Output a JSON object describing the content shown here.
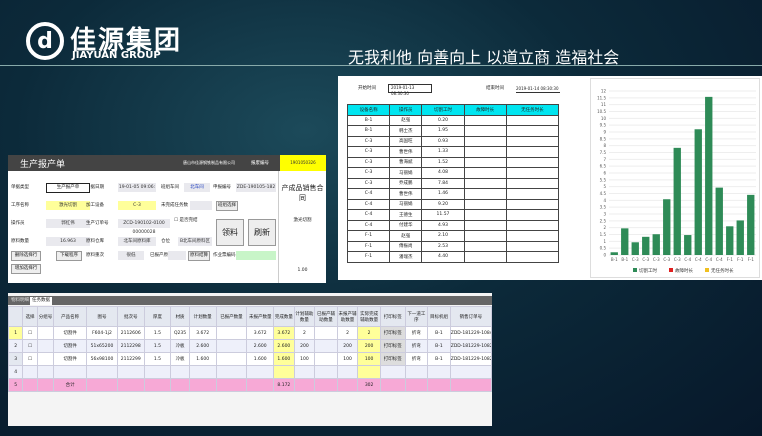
{
  "header": {
    "logo_mark": "d",
    "logo_cn": "佳源集团",
    "logo_en": "JIAYUAN GROUP",
    "slogan": "无我利他  向善向上  以道立商  造福社会"
  },
  "form": {
    "title": "生产报产单",
    "company": "唐山市佳源钢铁制品有限公司",
    "report_no_label": "报废编号",
    "report_no": "1901050326",
    "fields": [
      {
        "label": "单据类型",
        "value": "生产报产单"
      },
      {
        "label": "单据日期",
        "value": "19-01-05 09:06:"
      },
      {
        "label": "班组车间",
        "value": "北车间"
      },
      {
        "label": "申报编号",
        "value": "ZDE-190105-182"
      },
      {
        "label": "工序名称",
        "value": "激光切割"
      },
      {
        "label": "加工设备",
        "value": "C-3"
      },
      {
        "label": "未完成任务数",
        "value": ""
      },
      {
        "label": "操作员",
        "value": "郭红伟"
      },
      {
        "label": "生产订单号",
        "value": "ZCD-190102-0100  00000028"
      },
      {
        "label": "原料数量",
        "value": "16.963"
      },
      {
        "label": "原料仓库",
        "value": "北车间原料库"
      },
      {
        "label": "仓位",
        "value": "B北车间原料区"
      },
      {
        "label": "原料重次",
        "value": "很低"
      },
      {
        "label": "已报产原料",
        "value": ""
      },
      {
        "label": "作业票编码",
        "value": ""
      }
    ],
    "complete_label": "是否完结",
    "buttons": {
      "team": "班组选择",
      "pick": "领料",
      "refresh": "刷新",
      "delete_row": "删除选择行",
      "download": "下载程序",
      "settle": "原料结算",
      "add_row": "增加选择行"
    },
    "side": {
      "title": "产成品销售合同",
      "process": "激光切割",
      "value": "1.00"
    }
  },
  "report": {
    "start_label": "开始时间",
    "start": "2019-01-13 08:30:30",
    "end_label": "结束时间",
    "end": "2019-01-14 08:30:30",
    "columns": [
      "设备名称",
      "操作员",
      "切割工时",
      "故障时长",
      "无任务时长"
    ],
    "rows": [
      [
        "B-1",
        "赵强",
        "0.20"
      ],
      [
        "B-1",
        "韩士杰",
        "1.95"
      ],
      [
        "C-3",
        "高国旺",
        "0.93"
      ],
      [
        "C-3",
        "曹世伟",
        "1.33"
      ],
      [
        "C-3",
        "曹海斌",
        "1.52"
      ],
      [
        "C-3",
        "马丽娟",
        "4.08"
      ],
      [
        "C-3",
        "乔成鹏",
        "7.84"
      ],
      [
        "C-4",
        "曹世伟",
        "1.46"
      ],
      [
        "C-4",
        "马丽娟",
        "9.20"
      ],
      [
        "C-4",
        "王德生",
        "11.57"
      ],
      [
        "C-4",
        "付建华",
        "4.93"
      ],
      [
        "F-1",
        "赵强",
        "2.10"
      ],
      [
        "F-1",
        "傅振尚",
        "2.53"
      ],
      [
        "F-1",
        "潘瑞杰",
        "4.40"
      ]
    ]
  },
  "chart_data": {
    "type": "bar",
    "categories": [
      "B-1",
      "B-1",
      "C-3",
      "C-3",
      "C-3",
      "C-3",
      "C-3",
      "C-4",
      "C-4",
      "C-4",
      "C-4",
      "F-1",
      "F-1",
      "F-1"
    ],
    "series": [
      {
        "name": "切割工时",
        "color": "#2e8b57",
        "values": [
          0.2,
          1.95,
          0.93,
          1.33,
          1.52,
          4.08,
          7.84,
          1.46,
          9.2,
          11.57,
          4.93,
          2.1,
          2.53,
          4.4
        ]
      },
      {
        "name": "故障时长",
        "color": "#e02020",
        "values": []
      },
      {
        "name": "无任务时长",
        "color": "#f0c020",
        "values": []
      }
    ],
    "ylim": [
      0,
      12
    ],
    "ytick_step": 0.5,
    "grid": true,
    "legend": "bottom"
  },
  "grid": {
    "tabs": [
      "物料明细",
      "任务数据"
    ],
    "columns": [
      "选择",
      "分组号",
      "产品名称",
      "图号",
      "批次号",
      "厚度",
      "材质",
      "计划数量",
      "已报产数量",
      "未报产数量",
      "完成数量",
      "计划辅助数量",
      "已报产辅助数量",
      "未报产辅助数量",
      "实际完成辅助数量",
      "打印标签",
      "下一道工序",
      "目标机组",
      "销售订单号"
    ],
    "rows": [
      [
        "1",
        "",
        "",
        "切割件",
        "F604-1j2",
        "2112606",
        "1.5",
        "Q235",
        "3.672",
        "",
        "3.672",
        "3.672",
        "2",
        "",
        "2",
        "2",
        "打印标签",
        "折弯",
        "B-1",
        "ZDD-181229-1084"
      ],
      [
        "2",
        "",
        "",
        "切割件",
        "51x65200",
        "2112298",
        "1.5",
        "冷板",
        "2.600",
        "",
        "2.600",
        "2.600",
        "200",
        "",
        "200",
        "200",
        "打印标签",
        "折弯",
        "B-1",
        "ZDD-181229-1082"
      ],
      [
        "3",
        "",
        "",
        "切割件",
        "56x98100",
        "2112299",
        "1.5",
        "冷板",
        "1.600",
        "",
        "1.600",
        "1.600",
        "100",
        "",
        "100",
        "100",
        "打印标签",
        "折弯",
        "B-1",
        "ZDD-181229-1082"
      ],
      [
        "4",
        "",
        "",
        "",
        "",
        "",
        "",
        "",
        "",
        "",
        "",
        "",
        "",
        "",
        "",
        "",
        "",
        "",
        "",
        ""
      ]
    ],
    "sum": {
      "n": "5",
      "label": "合计",
      "done": "8.172",
      "aux": "302"
    }
  }
}
